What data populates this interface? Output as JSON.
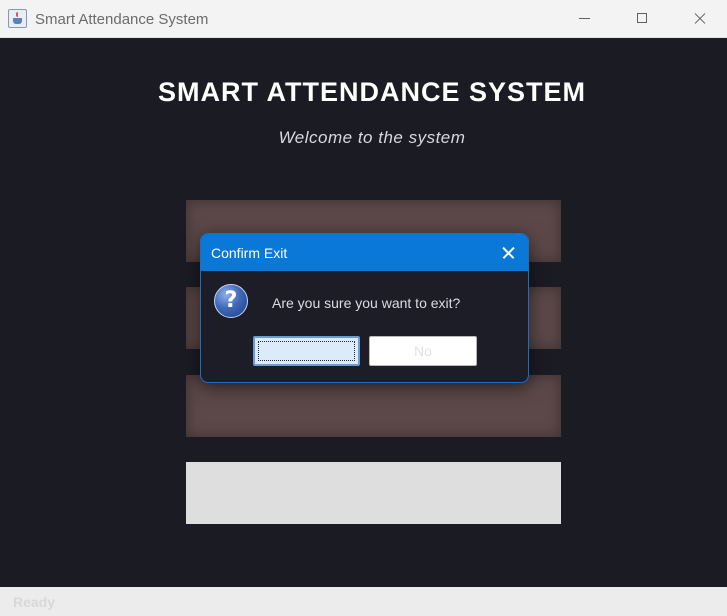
{
  "window": {
    "title": "Smart Attendance System",
    "icon": "java-cup-icon"
  },
  "main": {
    "heading": "SMART ATTENDANCE SYSTEM",
    "subtitle": "Welcome to the system"
  },
  "dialog": {
    "title": "Confirm Exit",
    "message": "Are you sure you want to exit?",
    "icon": "question-icon",
    "yes_label": "",
    "no_label": "No"
  },
  "status": {
    "text": "Ready"
  },
  "colors": {
    "background": "#1b1b24",
    "menu_button": "#5c4848",
    "dialog_title_bar": "#0a78d7"
  }
}
